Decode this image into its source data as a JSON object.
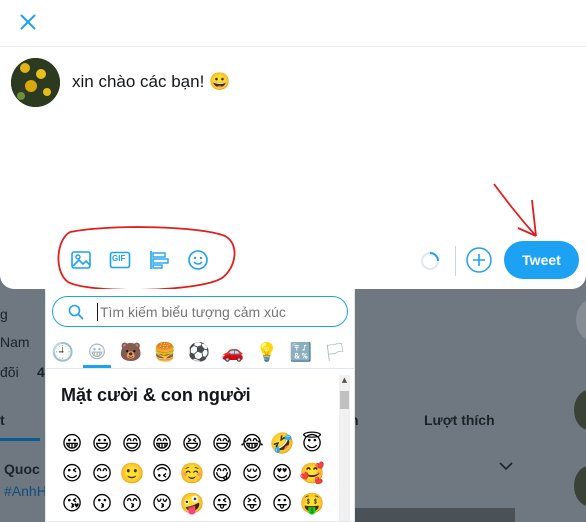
{
  "background": {
    "snippets": [
      "g",
      "Nam",
      "đõi",
      "4",
      "Quoc",
      "#AnhH"
    ],
    "tabs": {
      "t": "t",
      "n": "n",
      "liked": "Lượt thích"
    }
  },
  "modal": {
    "close_icon": "close-icon",
    "compose_text": "xin chào các bạn! 😀",
    "toolbar": {
      "media": "image-icon",
      "gif": "GIF",
      "poll": "poll-icon",
      "emoji": "smiley-icon"
    },
    "tweet_label": "Tweet",
    "accent": "#1da1f2",
    "annotation_color": "#e11d1d"
  },
  "picker": {
    "search_placeholder": "Tìm kiếm biểu tượng cảm xúc",
    "categories": [
      "🕘",
      "😀",
      "🐻",
      "🍔",
      "⚽",
      "🚗",
      "💡",
      "🔣",
      "🏳"
    ],
    "section_title": "Mặt cười & con người",
    "rows": [
      [
        "😀",
        "😃",
        "😄",
        "😁",
        "😆",
        "😅",
        "😂",
        "🤣",
        "😇"
      ],
      [
        "😉",
        "😊",
        "🙂",
        "🙃",
        "☺️",
        "😋",
        "😌",
        "😍",
        "🥰"
      ],
      [
        "😘",
        "😗",
        "😙",
        "😚",
        "🤪",
        "😜",
        "😝",
        "😛",
        "🤑"
      ]
    ]
  }
}
